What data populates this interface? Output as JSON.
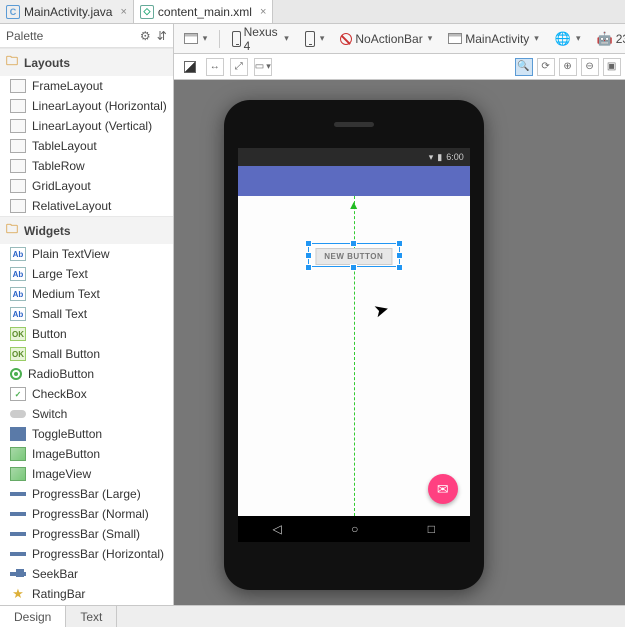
{
  "tabs": [
    {
      "label": "MainActivity.java",
      "icon": "C",
      "active": false
    },
    {
      "label": "content_main.xml",
      "icon": "◇",
      "active": true
    }
  ],
  "palette": {
    "title": "Palette",
    "categories": [
      {
        "name": "Layouts",
        "items": [
          {
            "label": "FrameLayout",
            "icon": "box"
          },
          {
            "label": "LinearLayout (Horizontal)",
            "icon": "box"
          },
          {
            "label": "LinearLayout (Vertical)",
            "icon": "box"
          },
          {
            "label": "TableLayout",
            "icon": "box"
          },
          {
            "label": "TableRow",
            "icon": "box"
          },
          {
            "label": "GridLayout",
            "icon": "box"
          },
          {
            "label": "RelativeLayout",
            "icon": "box"
          }
        ]
      },
      {
        "name": "Widgets",
        "items": [
          {
            "label": "Plain TextView",
            "icon": "ab"
          },
          {
            "label": "Large Text",
            "icon": "ab"
          },
          {
            "label": "Medium Text",
            "icon": "ab"
          },
          {
            "label": "Small Text",
            "icon": "ab"
          },
          {
            "label": "Button",
            "icon": "ok"
          },
          {
            "label": "Small Button",
            "icon": "ok"
          },
          {
            "label": "RadioButton",
            "icon": "radio"
          },
          {
            "label": "CheckBox",
            "icon": "check"
          },
          {
            "label": "Switch",
            "icon": "switch"
          },
          {
            "label": "ToggleButton",
            "icon": "toggle"
          },
          {
            "label": "ImageButton",
            "icon": "img"
          },
          {
            "label": "ImageView",
            "icon": "img"
          },
          {
            "label": "ProgressBar (Large)",
            "icon": "bar"
          },
          {
            "label": "ProgressBar (Normal)",
            "icon": "bar"
          },
          {
            "label": "ProgressBar (Small)",
            "icon": "bar"
          },
          {
            "label": "ProgressBar (Horizontal)",
            "icon": "bar"
          },
          {
            "label": "SeekBar",
            "icon": "seek"
          },
          {
            "label": "RatingBar",
            "icon": "star"
          }
        ]
      }
    ]
  },
  "toolbar": {
    "device": "Nexus 4",
    "theme": "NoActionBar",
    "activity": "MainActivity",
    "api": "23"
  },
  "device_preview": {
    "status_time": "6:00",
    "new_button_label": "NEW BUTTON",
    "fab_icon": "✉"
  },
  "bottom_tabs": {
    "design": "Design",
    "text": "Text"
  }
}
